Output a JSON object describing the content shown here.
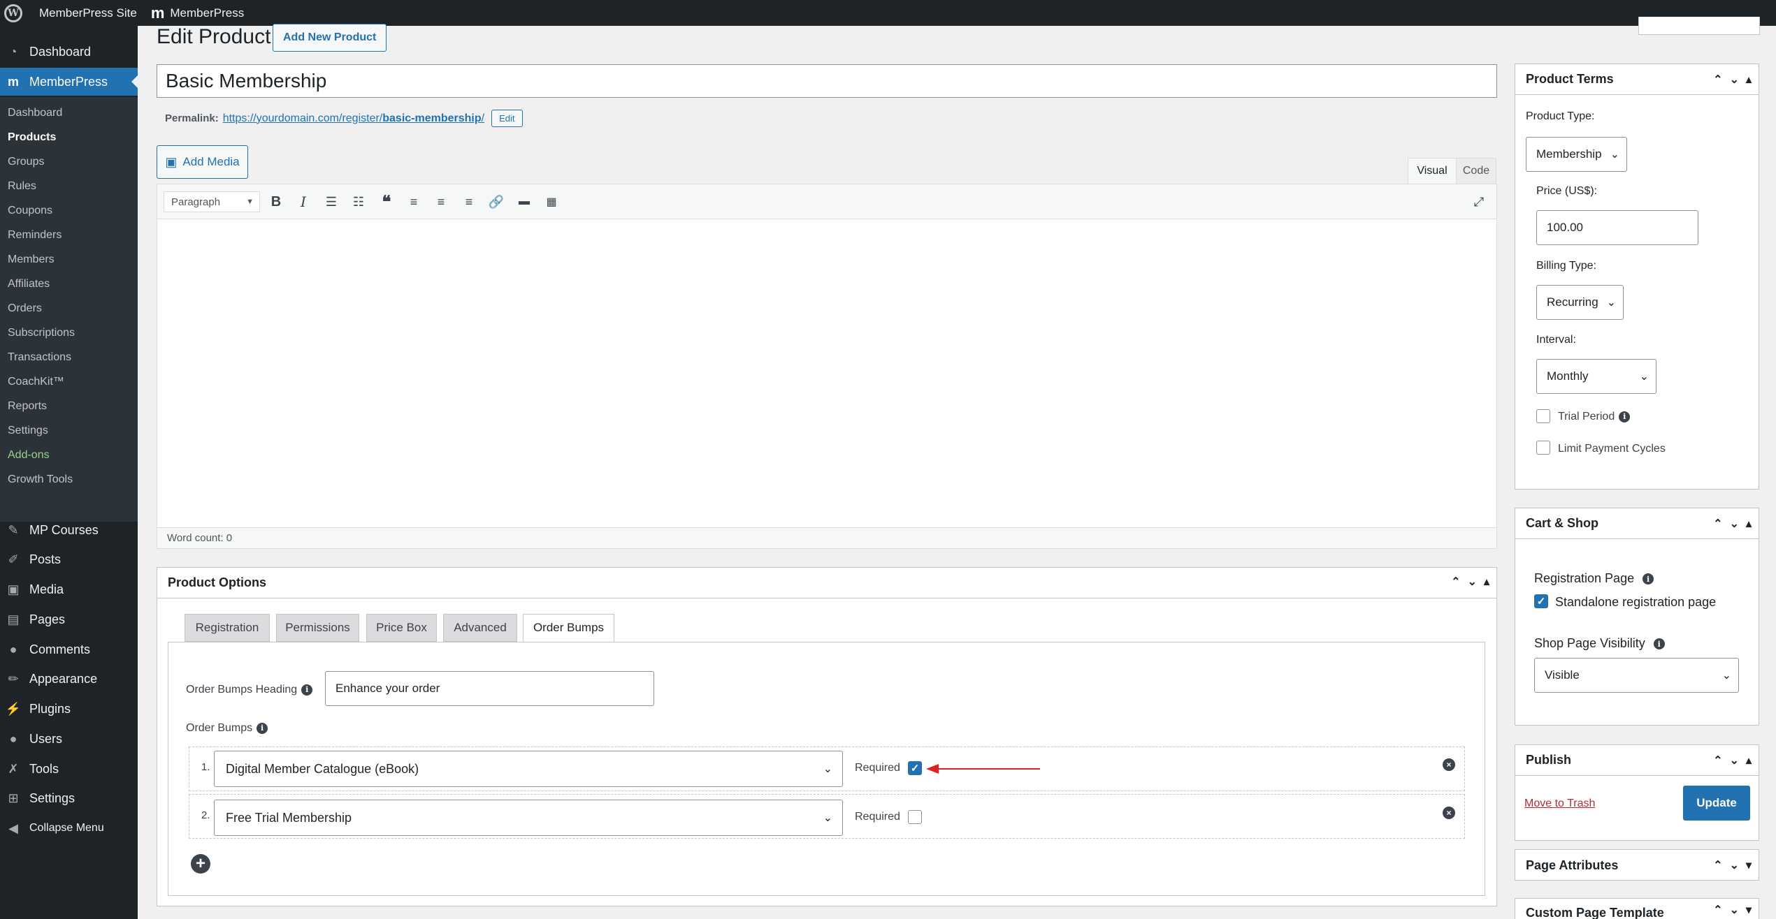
{
  "adminbar": {
    "wp_logo": "W",
    "site_name": "MemberPress Site",
    "mp_logo": "m",
    "plugin_name": "MemberPress"
  },
  "sidebar": {
    "top_items": [
      {
        "label": "Dashboard",
        "icon": "dashboard-icon"
      },
      {
        "label": "MemberPress",
        "icon": "memberpress-icon"
      }
    ],
    "submenu": [
      "Dashboard",
      "Products",
      "Groups",
      "Rules",
      "Coupons",
      "Reminders",
      "Members",
      "Affiliates",
      "Orders",
      "Subscriptions",
      "Transactions",
      "CoachKit™",
      "Reports",
      "Settings",
      "Add-ons",
      "Growth Tools"
    ],
    "bottom_items": [
      {
        "label": "MP Courses",
        "icon": "courses-icon"
      },
      {
        "label": "Posts",
        "icon": "pin-icon"
      },
      {
        "label": "Media",
        "icon": "media-icon"
      },
      {
        "label": "Pages",
        "icon": "pages-icon"
      },
      {
        "label": "Comments",
        "icon": "comment-icon"
      },
      {
        "label": "Appearance",
        "icon": "brush-icon"
      },
      {
        "label": "Plugins",
        "icon": "plug-icon"
      },
      {
        "label": "Users",
        "icon": "user-icon"
      },
      {
        "label": "Tools",
        "icon": "wrench-icon"
      },
      {
        "label": "Settings",
        "icon": "settings-icon"
      },
      {
        "label": "Collapse Menu",
        "icon": "collapse-icon"
      }
    ]
  },
  "page": {
    "title": "Edit Product",
    "add_new_label": "Add New Product",
    "product_title": "Basic Membership",
    "permalink_label": "Permalink:",
    "permalink_base": "https://yourdomain.com/register/",
    "permalink_slug": "basic-membership",
    "permalink_tail": "/",
    "edit_label": "Edit"
  },
  "editor": {
    "add_media_label": "Add Media",
    "tab_visual": "Visual",
    "tab_code": "Code",
    "format": "Paragraph",
    "word_count": "Word count: 0"
  },
  "product_options": {
    "title": "Product Options",
    "tabs": [
      "Registration",
      "Permissions",
      "Price Box",
      "Advanced",
      "Order Bumps"
    ],
    "heading_label": "Order Bumps Heading",
    "heading_value": "Enhance your order",
    "bumps_label": "Order Bumps",
    "required_label": "Required",
    "bumps": [
      {
        "index": "1.",
        "product": "Digital Member Catalogue (eBook)",
        "required": true
      },
      {
        "index": "2.",
        "product": "Free Trial Membership",
        "required": false
      }
    ]
  },
  "product_terms": {
    "title": "Product Terms",
    "type_label": "Product Type:",
    "type_value": "Membership",
    "price_label": "Price (US$):",
    "price_value": "100.00",
    "billing_label": "Billing Type:",
    "billing_value": "Recurring",
    "interval_label": "Interval:",
    "interval_value": "Monthly",
    "trial_label": "Trial Period",
    "limit_label": "Limit Payment Cycles"
  },
  "cart_shop": {
    "title": "Cart & Shop",
    "reg_page_label": "Registration Page",
    "standalone_label": "Standalone registration page",
    "visibility_label": "Shop Page Visibility",
    "visibility_value": "Visible"
  },
  "publish": {
    "title": "Publish",
    "trash_label": "Move to Trash",
    "update_label": "Update"
  },
  "page_attributes": {
    "title": "Page Attributes"
  },
  "custom_template": {
    "title": "Custom Page Template"
  },
  "colors": {
    "accent": "#2271b1",
    "sidebar": "#1d2327",
    "arrow": "#e02020"
  }
}
